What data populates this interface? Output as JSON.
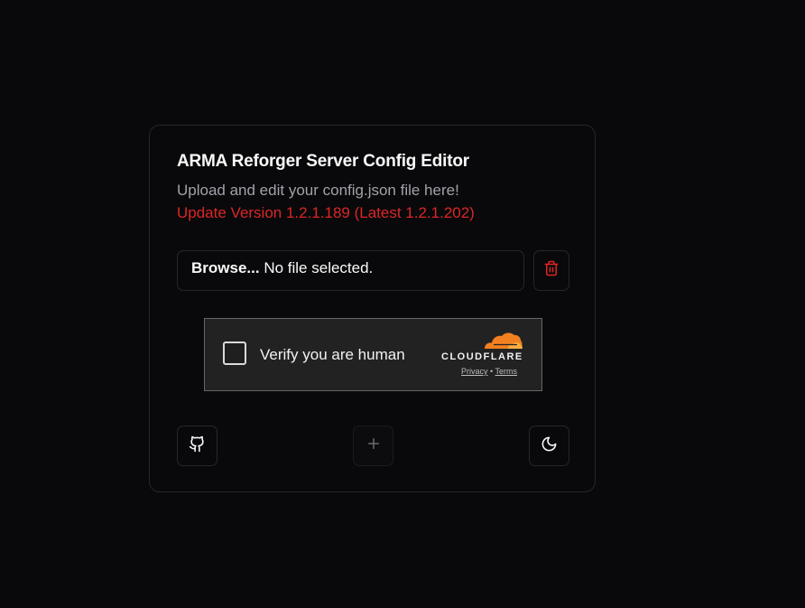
{
  "header": {
    "title": "ARMA Reforger Server Config Editor",
    "subtitle": "Upload and edit your config.json file here!",
    "version_notice": "Update Version 1.2.1.189 (Latest 1.2.1.202)"
  },
  "file_upload": {
    "browse_label": "Browse...",
    "status_text": "No file selected."
  },
  "turnstile": {
    "label": "Verify you are human",
    "brand": "CLOUDFLARE",
    "privacy_link": "Privacy",
    "separator": "•",
    "terms_link": "Terms"
  },
  "colors": {
    "background": "#09090b",
    "border": "#27272a",
    "warning": "#dc2626",
    "cloudflare_orange": "#f38020"
  },
  "icons": {
    "delete": "trash-icon",
    "github": "github-icon",
    "add": "plus-icon",
    "theme": "moon-icon"
  }
}
